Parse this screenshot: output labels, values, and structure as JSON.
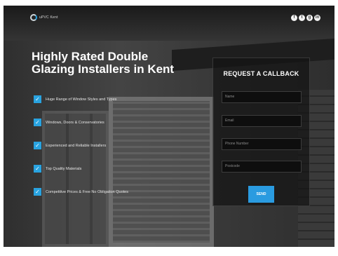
{
  "brand": {
    "logo_text": "uPVC Kent"
  },
  "social": {
    "icons": [
      {
        "name": "facebook-icon",
        "glyph": "f"
      },
      {
        "name": "twitter-icon",
        "glyph": "t"
      },
      {
        "name": "google-plus-icon",
        "glyph": "g"
      },
      {
        "name": "linkedin-icon",
        "glyph": "in"
      }
    ]
  },
  "hero": {
    "headline": "Highly Rated Double Glazing Installers in Kent",
    "features": [
      "Huge Range of Window Styles and Types",
      "Windows, Doors & Conservatories",
      "Experienced and Reliable Installers",
      "Top Quality Materials",
      "Competitive Prices & Free No Obligation Quotes"
    ]
  },
  "callback_form": {
    "title": "REQUEST A CALLBACK",
    "fields": {
      "name": "Name",
      "email": "Email",
      "phone": "Phone Number",
      "postcode": "Postcode"
    },
    "submit_label": "SEND"
  },
  "colors": {
    "accent": "#29a3e0",
    "button": "#2a9be0",
    "panel": "#141414"
  }
}
